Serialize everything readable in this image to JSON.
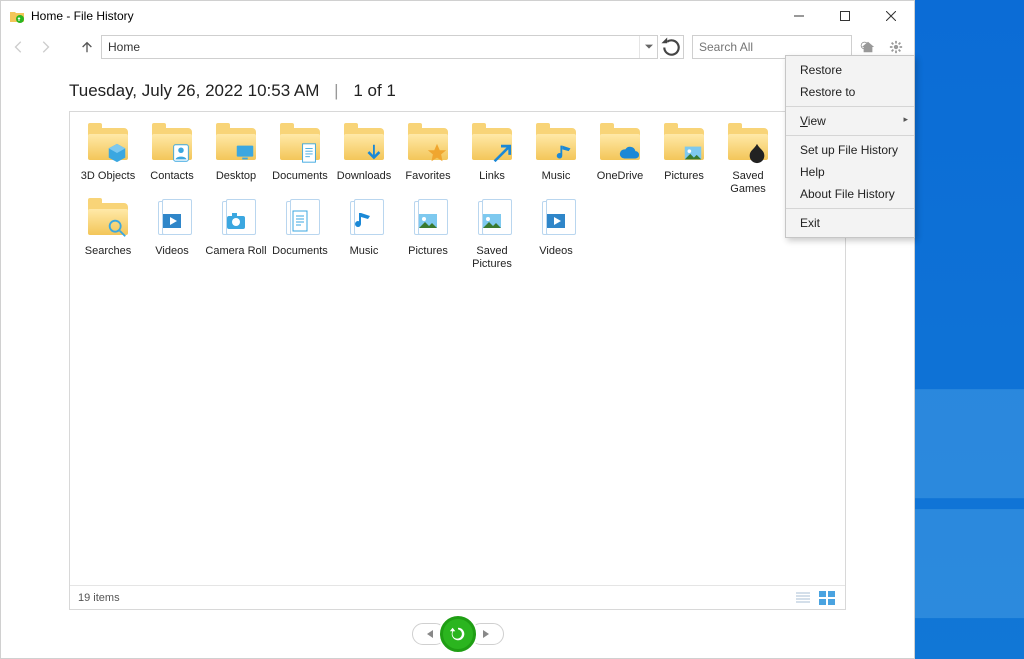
{
  "title": "Home - File History",
  "address": "Home",
  "search_placeholder": "Search All",
  "timestamp": "Tuesday, July 26, 2022 10:53 AM",
  "position": "1 of 1",
  "status": "19 items",
  "items": [
    {
      "label": "3D Objects",
      "type": "folder",
      "ov": "cube"
    },
    {
      "label": "Contacts",
      "type": "folder",
      "ov": "contact"
    },
    {
      "label": "Desktop",
      "type": "folder",
      "ov": "desktop"
    },
    {
      "label": "Documents",
      "type": "folder",
      "ov": "doc"
    },
    {
      "label": "Downloads",
      "type": "folder",
      "ov": "down"
    },
    {
      "label": "Favorites",
      "type": "folder",
      "ov": "star"
    },
    {
      "label": "Links",
      "type": "folder",
      "ov": "link"
    },
    {
      "label": "Music",
      "type": "folder",
      "ov": "music"
    },
    {
      "label": "OneDrive",
      "type": "folder",
      "ov": "cloud"
    },
    {
      "label": "Pictures",
      "type": "folder",
      "ov": "pic"
    },
    {
      "label": "Saved Games",
      "type": "folder",
      "ov": "game"
    },
    {
      "label": "Searches",
      "type": "folder",
      "ov": "search"
    },
    {
      "label": "Videos",
      "type": "lib",
      "ov": "video"
    },
    {
      "label": "Camera Roll",
      "type": "lib",
      "ov": "camera"
    },
    {
      "label": "Documents",
      "type": "lib",
      "ov": "doc"
    },
    {
      "label": "Music",
      "type": "lib",
      "ov": "music"
    },
    {
      "label": "Pictures",
      "type": "lib",
      "ov": "pic"
    },
    {
      "label": "Saved Pictures",
      "type": "lib",
      "ov": "pic"
    },
    {
      "label": "Videos",
      "type": "lib",
      "ov": "video"
    }
  ],
  "menu": {
    "restore": "Restore",
    "restore_to": "Restore to",
    "view": "View",
    "setup": "Set up File History",
    "help": "Help",
    "about": "About File History",
    "exit": "Exit"
  }
}
